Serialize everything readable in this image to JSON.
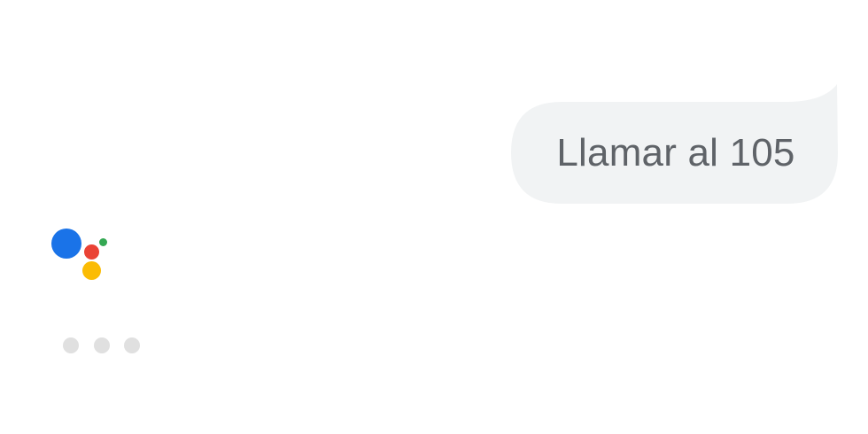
{
  "conversation": {
    "user_message": "Llamar al 105"
  },
  "assistant": {
    "logo_icon": "google-assistant-logo",
    "colors": {
      "blue": "#1a73e8",
      "red": "#ea4335",
      "yellow": "#fbbc04",
      "green": "#34a853"
    },
    "typing_indicator_icon": "typing-dots-icon",
    "typing_dot_color": "#e0e0e0"
  },
  "bubble_color": "#f1f3f4",
  "text_color": "#5f6368"
}
